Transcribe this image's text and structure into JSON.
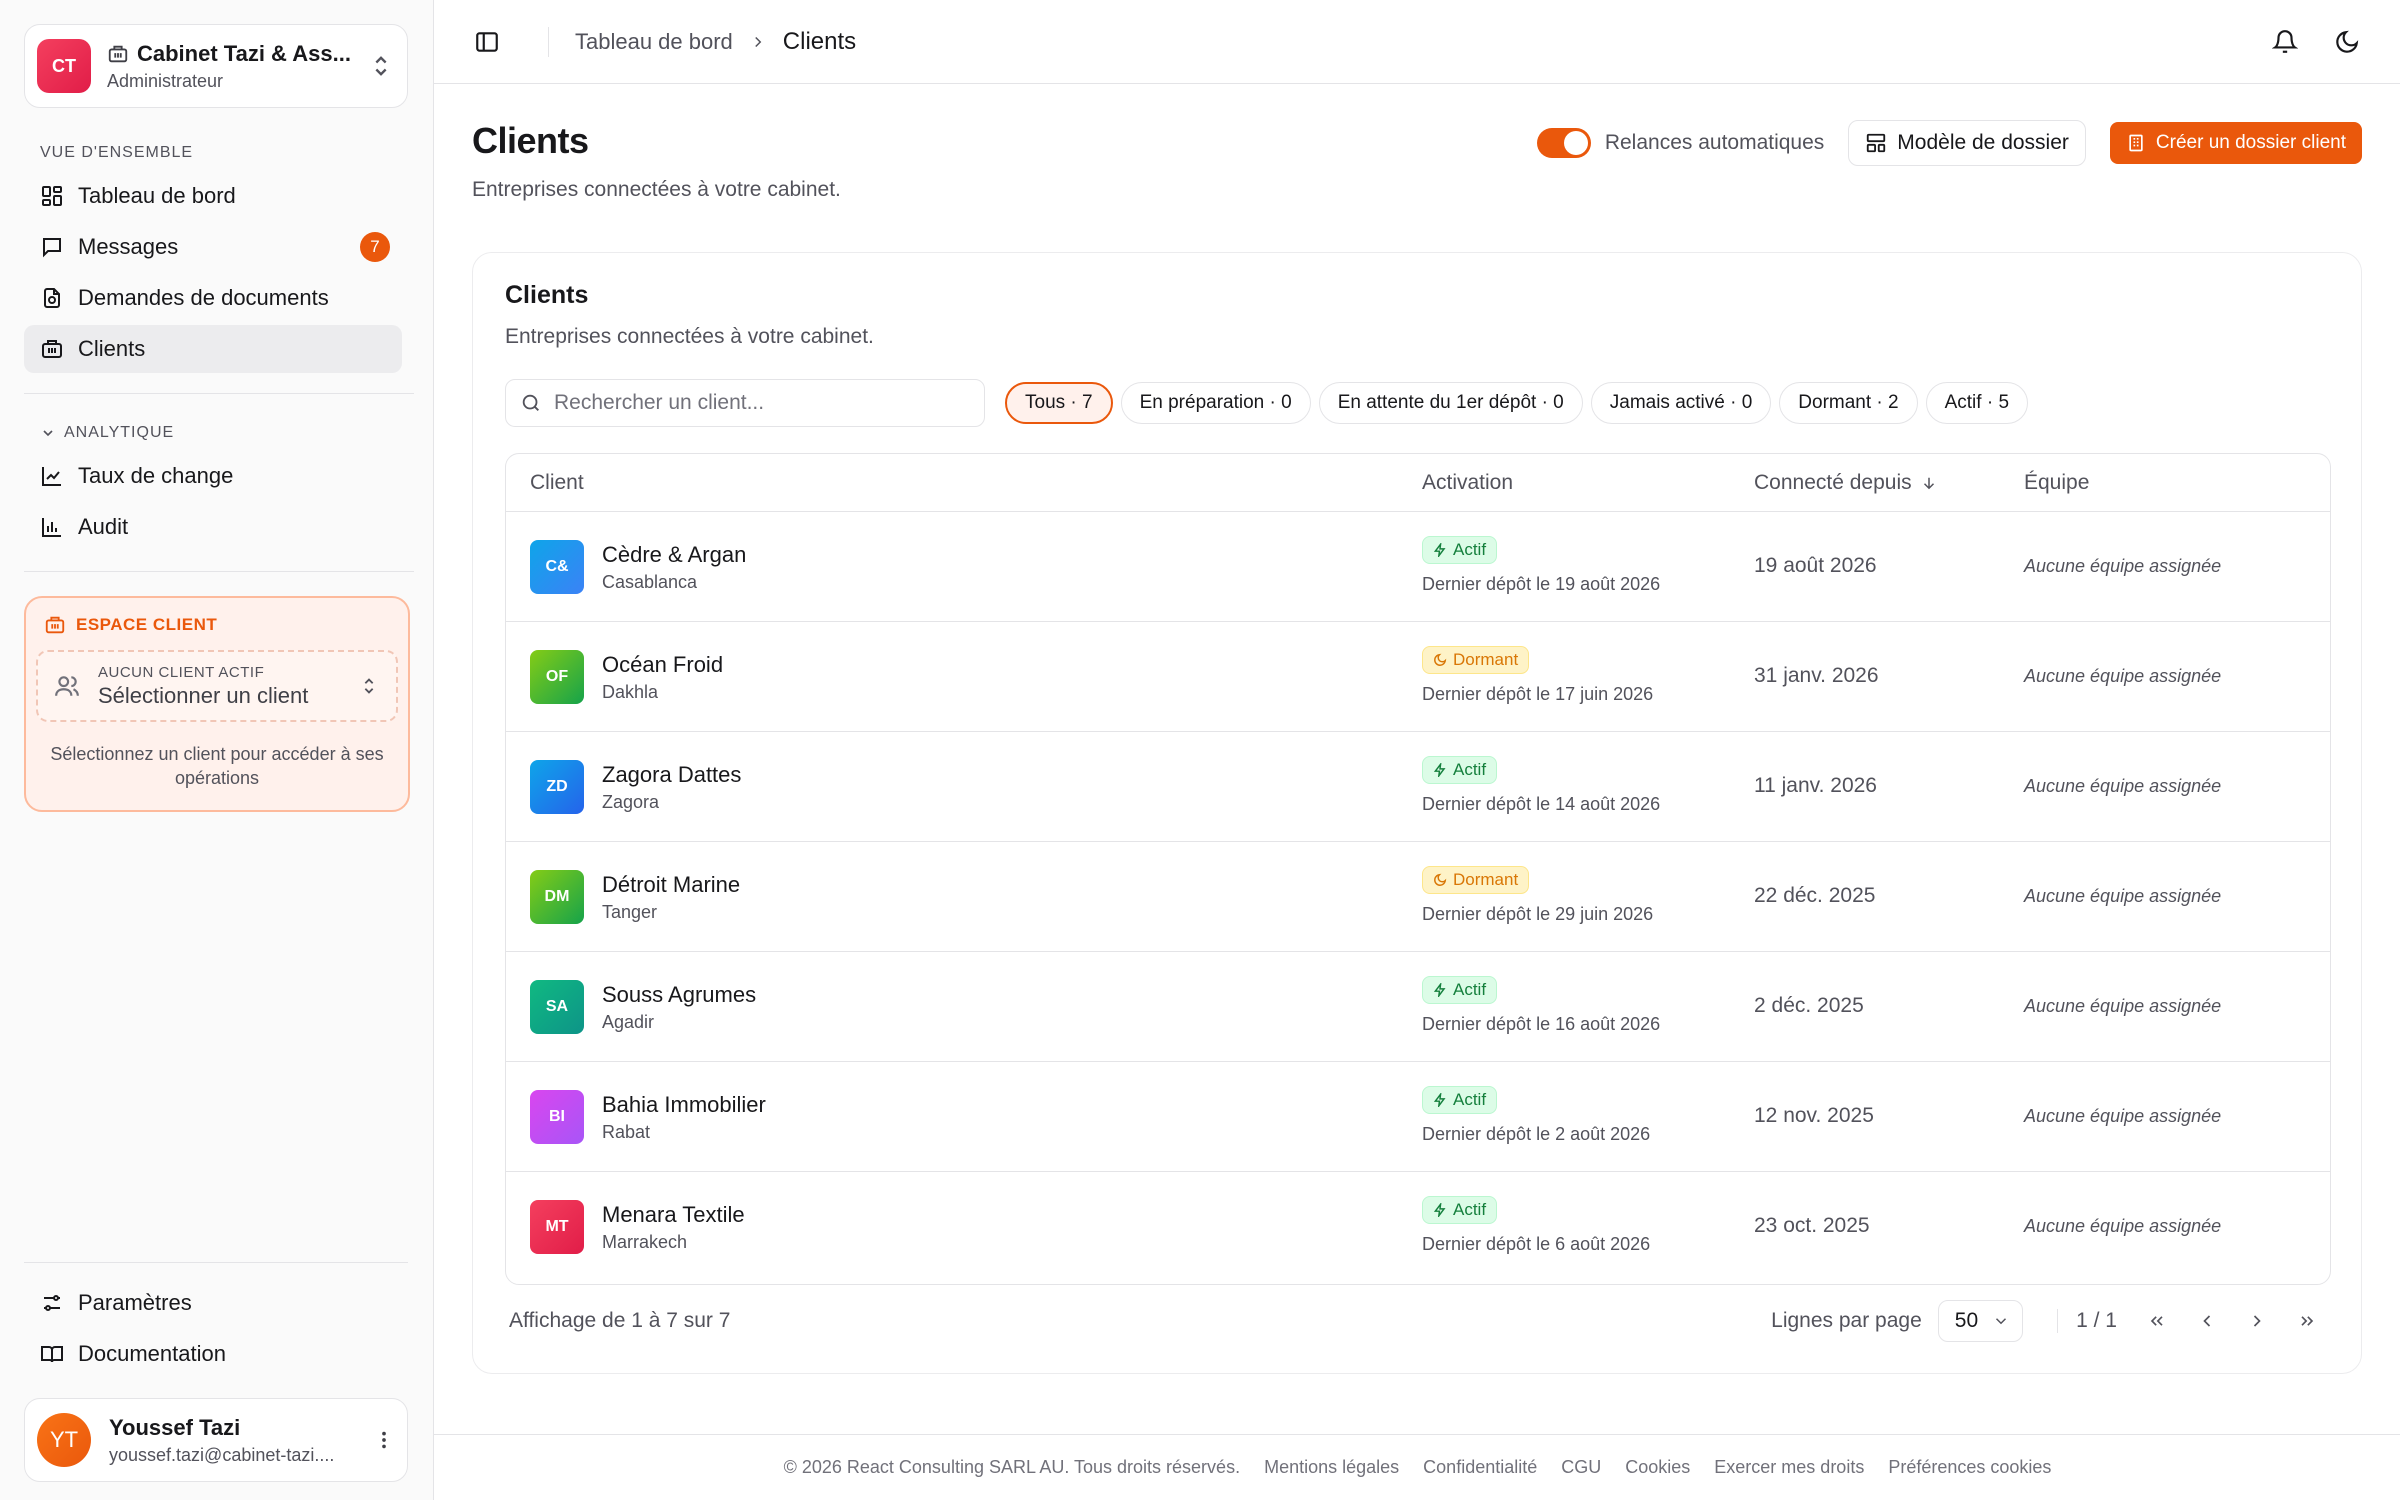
{
  "org": {
    "initials": "CT",
    "name": "Cabinet Tazi & Ass...",
    "role": "Administrateur"
  },
  "nav": {
    "section_overview": "VUE D'ENSEMBLE",
    "items": [
      {
        "label": "Tableau de bord",
        "icon": "dashboard-icon"
      },
      {
        "label": "Messages",
        "icon": "message-icon",
        "badge": "7"
      },
      {
        "label": "Demandes de documents",
        "icon": "document-request-icon"
      },
      {
        "label": "Clients",
        "icon": "building-icon",
        "active": true
      }
    ],
    "section_analytics": "ANALYTIQUE",
    "analytics": [
      {
        "label": "Taux de change",
        "icon": "line-chart-icon"
      },
      {
        "label": "Audit",
        "icon": "bar-chart-icon"
      }
    ]
  },
  "espace": {
    "title": "ESPACE CLIENT",
    "box_label": "AUCUN CLIENT ACTIF",
    "box_value": "Sélectionner un client",
    "hint": "Sélectionnez un client pour accéder à ses opérations"
  },
  "bottom_nav": {
    "settings": "Paramètres",
    "docs": "Documentation"
  },
  "user": {
    "initials": "YT",
    "name": "Youssef Tazi",
    "email": "youssef.tazi@cabinet-tazi...."
  },
  "breadcrumb": {
    "parent": "Tableau de bord",
    "current": "Clients"
  },
  "page": {
    "title": "Clients",
    "subtitle": "Entreprises connectées à votre cabinet."
  },
  "actions": {
    "toggle_label": "Relances automatiques",
    "template": "Modèle de dossier",
    "create": "Créer un dossier client"
  },
  "card": {
    "title": "Clients",
    "subtitle": "Entreprises connectées à votre cabinet."
  },
  "search": {
    "placeholder": "Rechercher un client..."
  },
  "filters": [
    "Tous · 7",
    "En préparation · 0",
    "En attente du 1er dépôt · 0",
    "Jamais activé · 0",
    "Dormant · 2",
    "Actif · 5"
  ],
  "table": {
    "headers": {
      "client": "Client",
      "activation": "Activation",
      "since": "Connecté depuis",
      "team": "Équipe"
    },
    "rows": [
      {
        "initials": "C&",
        "name": "Cèdre & Argan",
        "city": "Casablanca",
        "status": "Actif",
        "last": "Dernier dépôt le 19 août 2026",
        "since": "19 août 2026",
        "team": "Aucune équipe assignée",
        "color1": "#0ea5e9",
        "color2": "#3b82f6"
      },
      {
        "initials": "OF",
        "name": "Océan Froid",
        "city": "Dakhla",
        "status": "Dormant",
        "last": "Dernier dépôt le 17 juin 2026",
        "since": "31 janv. 2026",
        "team": "Aucune équipe assignée",
        "color1": "#84cc16",
        "color2": "#16a34a"
      },
      {
        "initials": "ZD",
        "name": "Zagora Dattes",
        "city": "Zagora",
        "status": "Actif",
        "last": "Dernier dépôt le 14 août 2026",
        "since": "11 janv. 2026",
        "team": "Aucune équipe assignée",
        "color1": "#0ea5e9",
        "color2": "#2563eb"
      },
      {
        "initials": "DM",
        "name": "Détroit Marine",
        "city": "Tanger",
        "status": "Dormant",
        "last": "Dernier dépôt le 29 juin 2026",
        "since": "22 déc. 2025",
        "team": "Aucune équipe assignée",
        "color1": "#84cc16",
        "color2": "#16a34a"
      },
      {
        "initials": "SA",
        "name": "Souss Agrumes",
        "city": "Agadir",
        "status": "Actif",
        "last": "Dernier dépôt le 16 août 2026",
        "since": "2 déc. 2025",
        "team": "Aucune équipe assignée",
        "color1": "#10b981",
        "color2": "#0d9488"
      },
      {
        "initials": "BI",
        "name": "Bahia Immobilier",
        "city": "Rabat",
        "status": "Actif",
        "last": "Dernier dépôt le 2 août 2026",
        "since": "12 nov. 2025",
        "team": "Aucune équipe assignée",
        "color1": "#d946ef",
        "color2": "#a855f7"
      },
      {
        "initials": "MT",
        "name": "Menara Textile",
        "city": "Marrakech",
        "status": "Actif",
        "last": "Dernier dépôt le 6 août 2026",
        "since": "23 oct. 2025",
        "team": "Aucune équipe assignée",
        "color1": "#f43f5e",
        "color2": "#e11d48"
      }
    ]
  },
  "pager": {
    "showing": "Affichage de 1 à 7 sur 7",
    "rows_label": "Lignes par page",
    "rows_value": "50",
    "page": "1 / 1"
  },
  "footer": [
    "© 2026 React Consulting SARL AU. Tous droits réservés.",
    "Mentions légales",
    "Confidentialité",
    "CGU",
    "Cookies",
    "Exercer mes droits",
    "Préférences cookies"
  ]
}
